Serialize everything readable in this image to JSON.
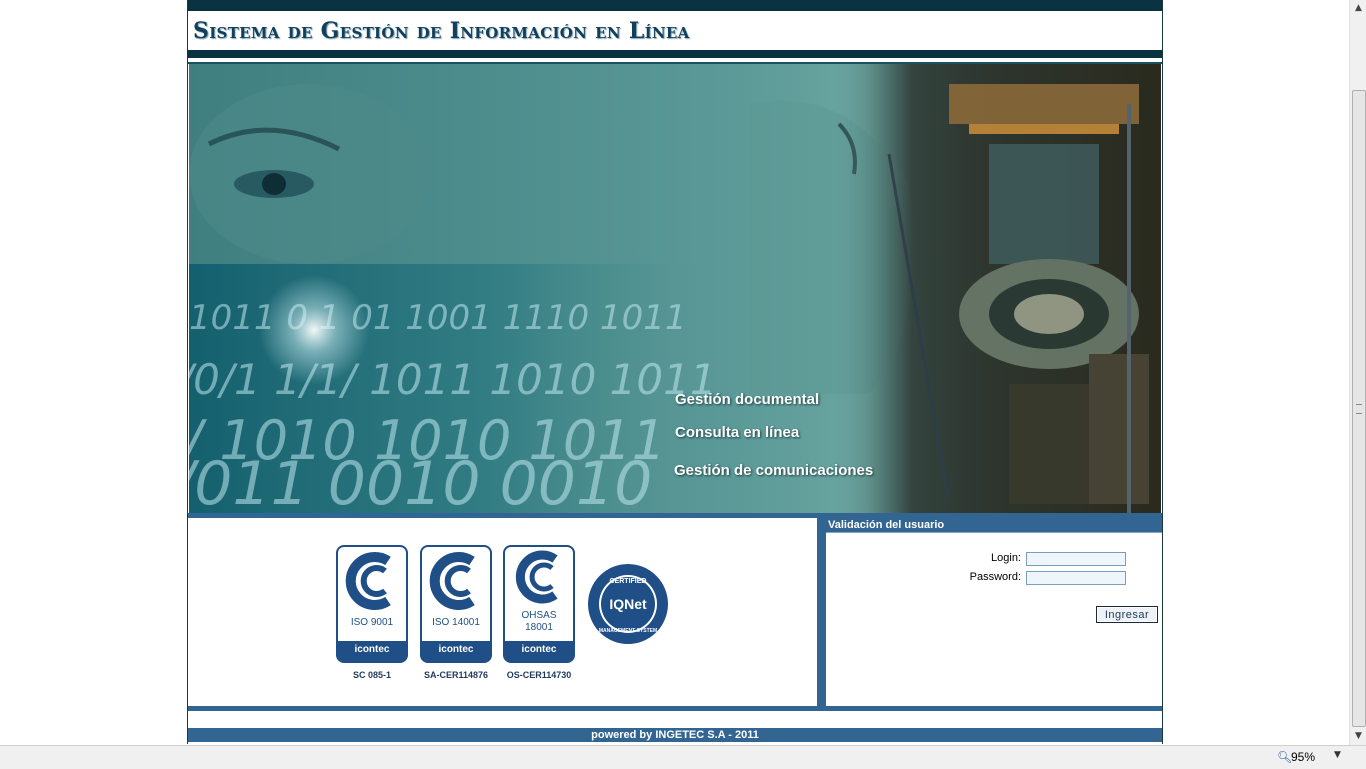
{
  "header": {
    "title": "Sistema de Gestión de Información en Línea"
  },
  "banner": {
    "labels": [
      "Gestión documental",
      "Consulta en línea",
      "Gestión de comunicaciones"
    ]
  },
  "certifications": [
    {
      "name_line1": "ISO 9001",
      "name_line2": "",
      "brand": "icontec",
      "code": "SC 085-1"
    },
    {
      "name_line1": "ISO 14001",
      "name_line2": "",
      "brand": "icontec",
      "code": "SA-CER114876"
    },
    {
      "name_line1": "OHSAS",
      "name_line2": "18001",
      "brand": "icontec",
      "code": "OS-CER114730"
    }
  ],
  "iqnet": {
    "brand": "IQNet"
  },
  "login": {
    "header": "Validación del usuario",
    "login_label": "Login:",
    "password_label": "Password:",
    "login_value": "",
    "password_value": "",
    "submit_label": "Ingresar"
  },
  "footer": {
    "text": "powered by INGETEC S.A - 2011"
  },
  "statusbar": {
    "zoom": "95%"
  },
  "colors": {
    "dark_teal": "#0a3242",
    "steel_blue": "#336592",
    "cert_blue": "#1f4f86"
  }
}
